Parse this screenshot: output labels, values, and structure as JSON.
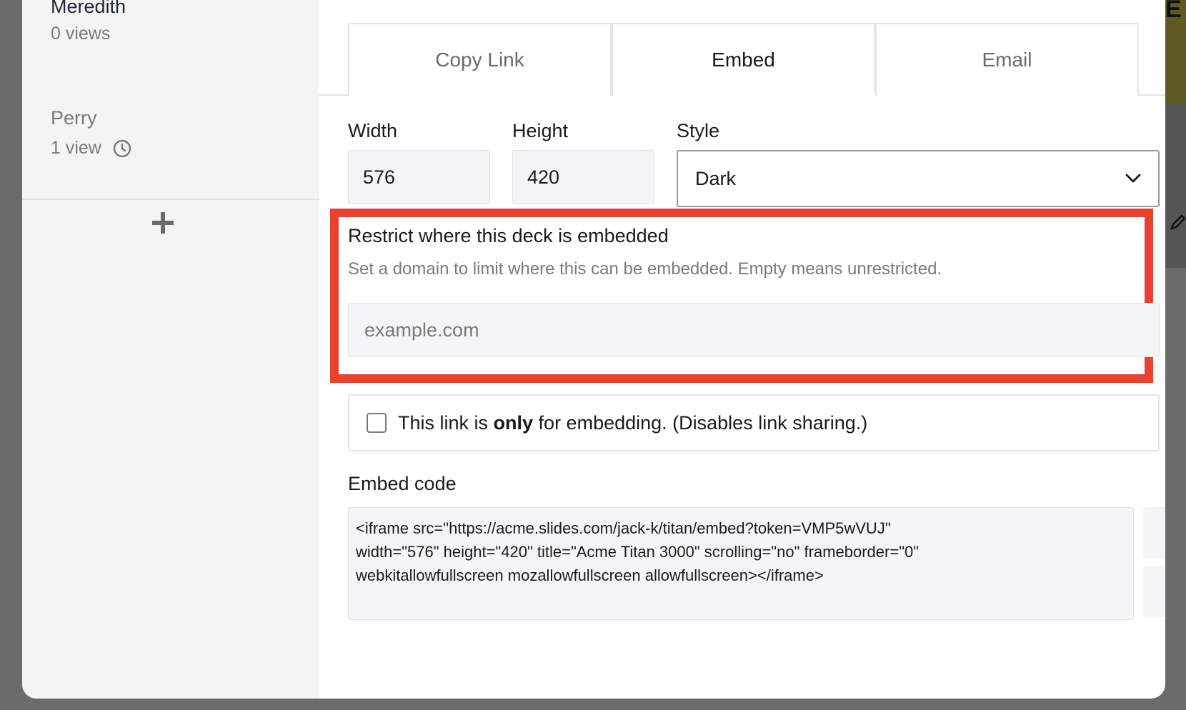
{
  "background": {
    "right_edge_text": "E"
  },
  "viewers": [
    {
      "name": "Meredith",
      "views": "0 views"
    },
    {
      "name": "Perry",
      "views": "1 view"
    }
  ],
  "tabs": [
    {
      "label": "Copy Link",
      "active": false
    },
    {
      "label": "Embed",
      "active": true
    },
    {
      "label": "Email",
      "active": false
    }
  ],
  "embed_settings": {
    "width_label": "Width",
    "width_value": "576",
    "height_label": "Height",
    "height_value": "420",
    "style_label": "Style",
    "style_value": "Dark"
  },
  "restrict": {
    "title": "Restrict where this deck is embedded",
    "subtitle": "Set a domain to limit where this can be embedded. Empty means unrestricted.",
    "domain_placeholder": "example.com",
    "domain_value": ""
  },
  "embed_only": {
    "checked": false,
    "text_before": "This link is ",
    "text_bold": "only",
    "text_after": " for embedding. (Disables link sharing.)"
  },
  "embed_code": {
    "label": "Embed code",
    "code": "<iframe src=\"https://acme.slides.com/jack-k/titan/embed?token=VMP5wVUJ\"\nwidth=\"576\" height=\"420\" title=\"Acme Titan 3000\" scrolling=\"no\" frameborder=\"0\"\nwebkitallowfullscreen mozallowfullscreen allowfullscreen></iframe>"
  },
  "colors": {
    "highlight": "#e8412f",
    "field_bg": "#f4f5f7",
    "muted_text": "#7a7a7a"
  }
}
